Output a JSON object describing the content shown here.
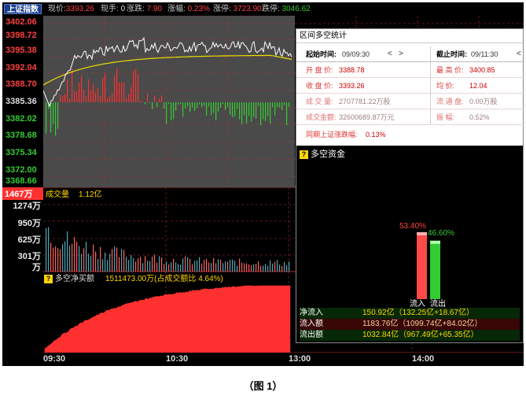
{
  "quote_bar": {
    "index_name": "上证指数",
    "items": [
      {
        "label": "现价:",
        "value": "3393.26",
        "color": "red"
      },
      {
        "label": "现手:",
        "value": "0",
        "color": "white"
      },
      {
        "label": "涨跌:",
        "value": "7.90",
        "color": "red"
      },
      {
        "label": "涨幅:",
        "value": "0.23%",
        "color": "red"
      },
      {
        "label": "涨停:",
        "value": "3723.90",
        "color": "red"
      },
      {
        "label": "跌停:",
        "value": "3046.62",
        "color": "green"
      }
    ]
  },
  "price_axis": [
    "3402.06",
    "3398.72",
    "3395.38",
    "3392.04",
    "3388.70",
    "3385.36",
    "3382.02",
    "3378.68",
    "3375.34",
    "3372.00",
    "3368.66"
  ],
  "volume_axis": [
    "1467万",
    "1274万",
    "950万",
    "625万",
    "301万",
    "万"
  ],
  "volume_title": {
    "label": "成交量",
    "value": "1.12亿"
  },
  "net_buy_title": {
    "label": "多空净买额",
    "value": "1511473.00万(占成交额比 4.64%)"
  },
  "time_axis": [
    "09:30",
    "10:30",
    "13:00",
    "14:00"
  ],
  "dialog": {
    "title": "区间多空统计",
    "start_label": "起始时间:",
    "start_value": "09/09:30",
    "end_label": "截止时间:",
    "end_value": "09/11:30",
    "rows": [
      [
        {
          "label": "开 盘 价:",
          "value": "3388.78"
        },
        {
          "label": "最 高 价:",
          "value": "3400.85"
        }
      ],
      [
        {
          "label": "收 盘 价:",
          "value": "3393.26"
        },
        {
          "label": "均     价:",
          "value": "12.04"
        }
      ],
      [
        {
          "label": "成 交 量:",
          "value": "2707781.22万股"
        },
        {
          "label": "流 通 盘:",
          "value": "0.00万股"
        }
      ],
      [
        {
          "label": "成交金额:",
          "value": "32600689.87万元"
        },
        {
          "label": "振     幅:",
          "value": "0.52%"
        }
      ]
    ],
    "same_period_label": "同期上证涨跌幅:",
    "same_period_value": "0.13%",
    "flow": {
      "title": "多空资金",
      "inflow_pct": "53.40%",
      "outflow_pct": "46.60%",
      "inflow_share": 0.534,
      "outflow_share": 0.466,
      "inflow_label": "流入",
      "outflow_label": "流出",
      "rows": [
        {
          "label": "净流入",
          "value": "150.92亿（132.25亿+18.67亿）"
        },
        {
          "label": "流入额",
          "value": "1183.76亿（1099.74亿+84.02亿）"
        },
        {
          "label": "流出额",
          "value": "1032.84亿（967.49亿+65.35亿）"
        }
      ]
    }
  },
  "caption": "（图 1）",
  "colors": {
    "up": "#ff3030",
    "down": "#33cc33",
    "price_line": "#ffffff",
    "avg_line": "#e8e000"
  }
}
